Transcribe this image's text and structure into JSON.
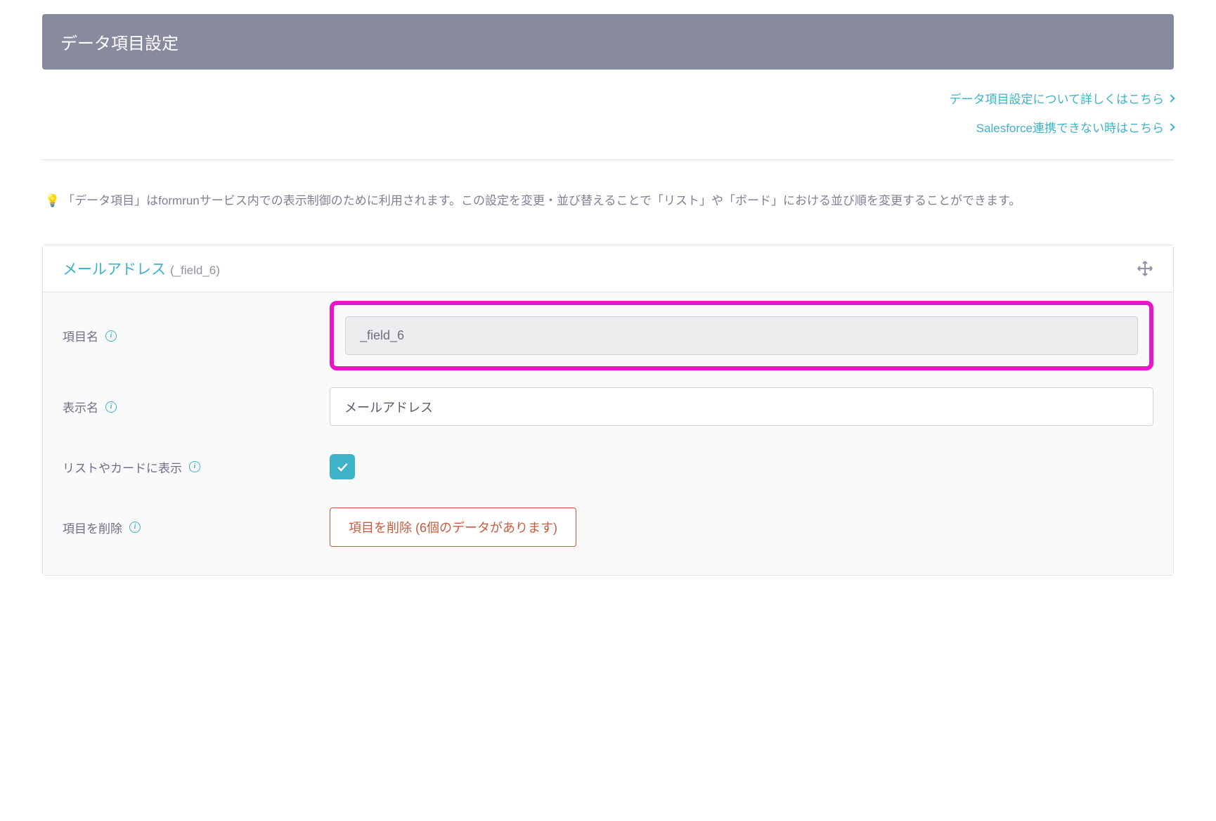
{
  "header": {
    "title": "データ項目設定"
  },
  "help_links": {
    "settings_help": "データ項目設定について詳しくはこちら",
    "salesforce_help": "Salesforce連携できない時はこちら"
  },
  "info": {
    "emoji": "💡",
    "text": "「データ項目」はformrunサービス内での表示制御のために利用されます。この設定を変更・並び替えることで「リスト」や「ボード」における並び順を変更することができます。"
  },
  "field": {
    "title": "メールアドレス",
    "id_display": "(_field_6)",
    "labels": {
      "item_name": "項目名",
      "display_name": "表示名",
      "show_in_list": "リストやカードに表示",
      "delete_item": "項目を削除"
    },
    "values": {
      "item_name": "_field_6",
      "display_name": "メールアドレス",
      "show_in_list_checked": true
    },
    "delete_button": "項目を削除 (6個のデータがあります)"
  }
}
